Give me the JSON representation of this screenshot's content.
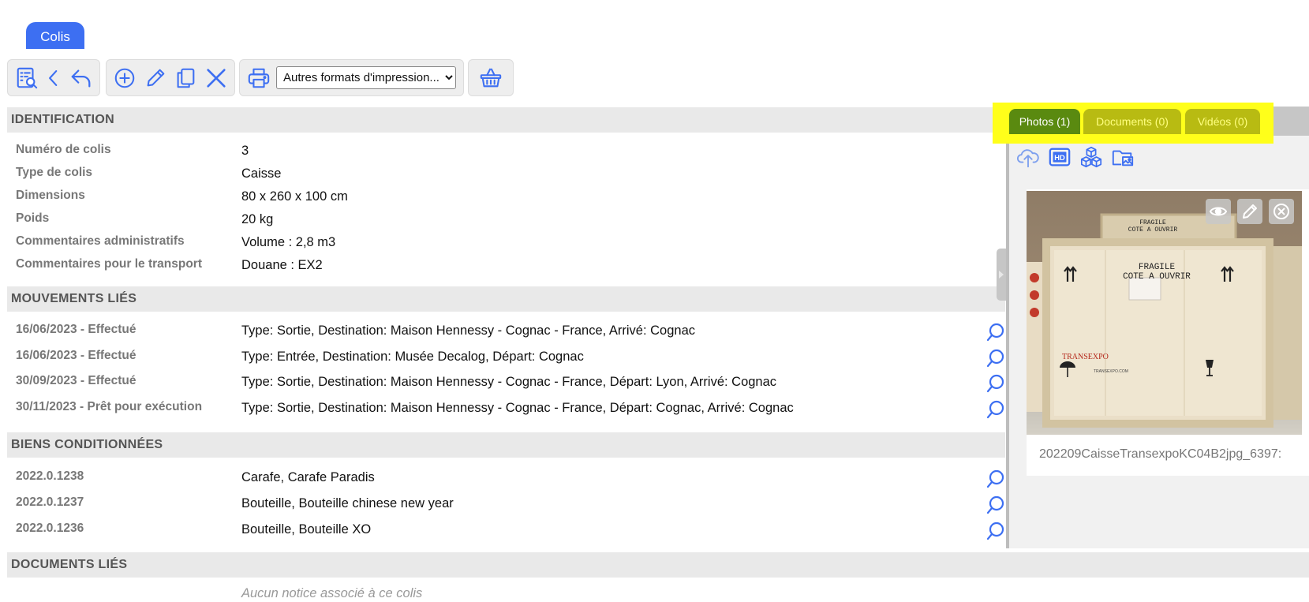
{
  "tab": {
    "label": "Colis"
  },
  "toolbar": {
    "print_select": {
      "selected": "Autres formats d'impression..."
    }
  },
  "sections": {
    "identification": {
      "title": "IDENTIFICATION",
      "rows": [
        {
          "label": "Numéro de colis",
          "value": "3"
        },
        {
          "label": "Type de colis",
          "value": "Caisse"
        },
        {
          "label": "Dimensions",
          "value": "80 x 260 x 100 cm"
        },
        {
          "label": "Poids",
          "value": "20 kg"
        },
        {
          "label": "Commentaires administratifs",
          "value": "Volume : 2,8 m3"
        },
        {
          "label": "Commentaires pour le transport",
          "value": "Douane : EX2"
        }
      ]
    },
    "mouvements": {
      "title": "MOUVEMENTS LIÉS",
      "rows": [
        {
          "label": "16/06/2023 - Effectué",
          "value": "Type: Sortie, Destination: Maison Hennessy - Cognac - France, Arrivé: Cognac"
        },
        {
          "label": "16/06/2023 - Effectué",
          "value": "Type: Entrée, Destination: Musée Decalog, Départ: Cognac"
        },
        {
          "label": "30/09/2023 - Effectué",
          "value": "Type: Sortie, Destination: Maison Hennessy - Cognac - France, Départ: Lyon, Arrivé: Cognac"
        },
        {
          "label": "30/11/2023 - Prêt pour exécution",
          "value": "Type: Sortie, Destination: Maison Hennessy - Cognac - France, Départ: Cognac, Arrivé: Cognac"
        }
      ]
    },
    "biens": {
      "title": "BIENS CONDITIONNÉES",
      "rows": [
        {
          "label": "2022.0.1238",
          "value": "Carafe, Carafe Paradis"
        },
        {
          "label": "2022.0.1237",
          "value": "Bouteille, Bouteille chinese new year"
        },
        {
          "label": "2022.0.1236",
          "value": "Bouteille, Bouteille XO"
        }
      ]
    },
    "documents": {
      "title": "DOCUMENTS LIÉS",
      "empty_text": "Aucun notice associé à ce colis"
    }
  },
  "media_panel": {
    "tabs": [
      {
        "label": "Photos (1)",
        "active": true
      },
      {
        "label": "Documents (0)",
        "active": false
      },
      {
        "label": "Vidéos (0)",
        "active": false
      }
    ],
    "photo": {
      "caption": "202209CaisseTransexpoKC04B2jpg_6397:",
      "crate_text": {
        "line1": "FRAGILE",
        "line2": "COTE A OUVRIR",
        "brand": "TRANSEXPO",
        "small": "TRANSEXPO.COM"
      }
    }
  },
  "colors": {
    "accent": "#3d6ff2",
    "active_tab": "#5a8a10",
    "inactive_tab": "#b8bb12",
    "highlight": "#ffff1a",
    "section_bg": "#e9e9e9"
  },
  "icons": {
    "toolbar": [
      "search-list-icon",
      "chevron-left-icon",
      "undo-arrow-icon",
      "add-circle-icon",
      "pencil-icon",
      "copy-icon",
      "close-x-icon",
      "printer-icon",
      "basket-icon"
    ],
    "media_tools": [
      "cloud-upload-icon",
      "hd-icon",
      "cubes-icon",
      "folder-image-icon"
    ],
    "photo_actions": [
      "eye-icon",
      "pencil-icon",
      "close-circle-icon"
    ]
  }
}
